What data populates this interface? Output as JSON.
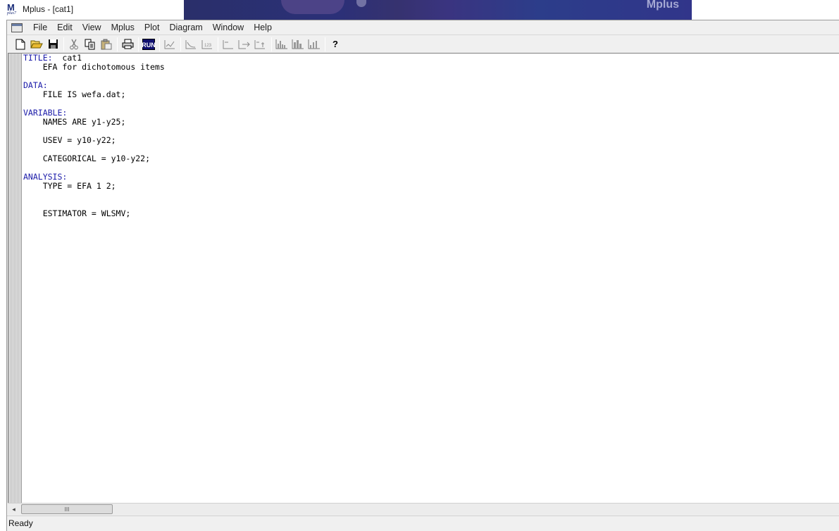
{
  "window": {
    "title": "Mplus - [cat1]",
    "icon": "mplus-app-icon",
    "icon_letter": "M",
    "icon_subtext": "plus7",
    "banner_logo": "Mplus"
  },
  "menu": {
    "items": [
      "File",
      "Edit",
      "View",
      "Mplus",
      "Plot",
      "Diagram",
      "Window",
      "Help"
    ]
  },
  "toolbar": {
    "buttons": [
      "new",
      "open",
      "save",
      "cut",
      "copy",
      "paste",
      "print",
      "run",
      "plot-1",
      "plot-2",
      "plot-3",
      "plot-4",
      "plot-5",
      "plot-6",
      "diagram-1",
      "diagram-2",
      "diagram-3",
      "help"
    ],
    "run_label": "RUN",
    "plot3_label": "123",
    "help_label": "?"
  },
  "editor": {
    "lines": [
      {
        "kw": "TITLE:",
        "text": "  cat1"
      },
      {
        "kw": "",
        "text": "    EFA for dichotomous items"
      },
      {
        "kw": "",
        "text": ""
      },
      {
        "kw": "DATA:",
        "text": ""
      },
      {
        "kw": "",
        "text": "    FILE IS wefa.dat;"
      },
      {
        "kw": "",
        "text": ""
      },
      {
        "kw": "VARIABLE:",
        "text": ""
      },
      {
        "kw": "",
        "text": "    NAMES ARE y1-y25;"
      },
      {
        "kw": "",
        "text": ""
      },
      {
        "kw": "",
        "text": "    USEV = y10-y22;"
      },
      {
        "kw": "",
        "text": ""
      },
      {
        "kw": "",
        "text": "    CATEGORICAL = y10-y22;"
      },
      {
        "kw": "",
        "text": ""
      },
      {
        "kw": "ANALYSIS:",
        "text": ""
      },
      {
        "kw": "",
        "text": "    TYPE = EFA 1 2;"
      },
      {
        "kw": "",
        "text": ""
      },
      {
        "kw": "",
        "text": ""
      },
      {
        "kw": "",
        "text": "    ESTIMATOR = WLSMV;"
      }
    ]
  },
  "scrollbar": {
    "thumb_grip": "III",
    "left_arrow": "◂"
  },
  "status": {
    "text": "Ready"
  },
  "colors": {
    "keyword": "#1a1aa8",
    "chrome": "#f0f0f0"
  }
}
